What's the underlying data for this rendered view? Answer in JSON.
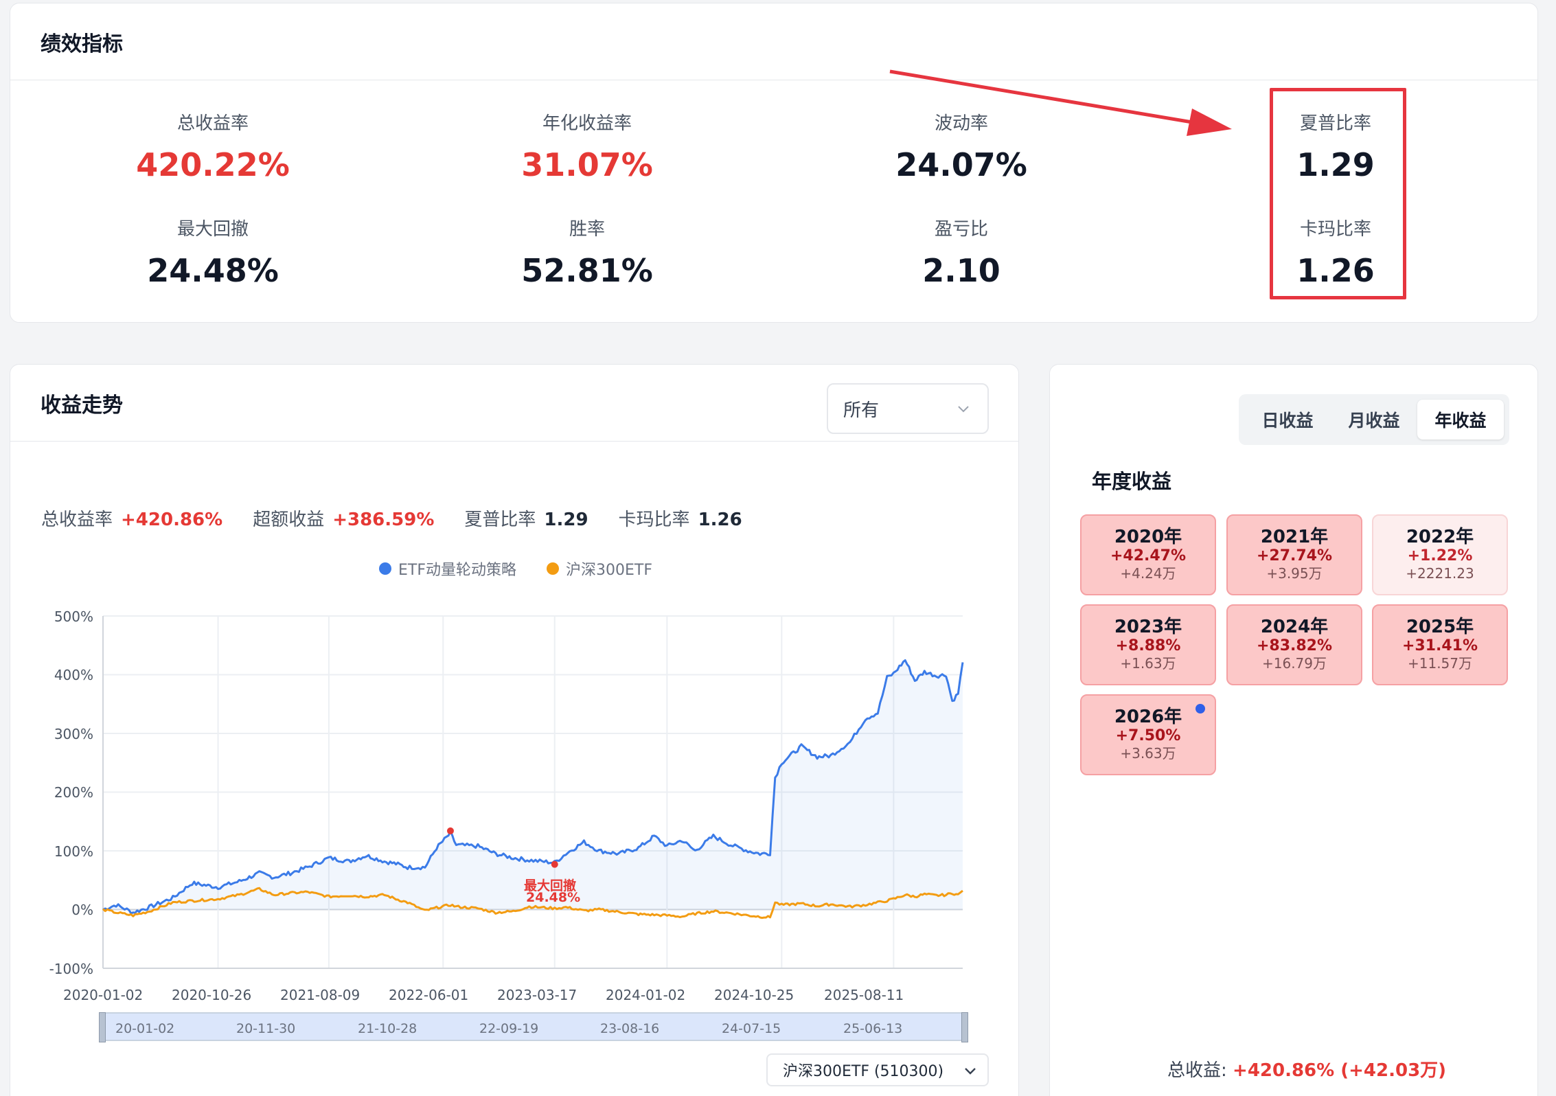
{
  "metrics_card": {
    "title": "绩效指标",
    "items": [
      {
        "label": "总收益率",
        "value": "420.22%"
      },
      {
        "label": "年化收益率",
        "value": "31.07%"
      },
      {
        "label": "波动率",
        "value": "24.07%"
      },
      {
        "label": "夏普比率",
        "value": "1.29"
      },
      {
        "label": "最大回撤",
        "value": "24.48%"
      },
      {
        "label": "胜率",
        "value": "52.81%"
      },
      {
        "label": "盈亏比",
        "value": "2.10"
      },
      {
        "label": "卡玛比率",
        "value": "1.26"
      }
    ],
    "highlight_color": "#e6353f"
  },
  "trend_card": {
    "title": "收益走势",
    "range_select": "所有",
    "stats": [
      {
        "label": "总收益率",
        "value": "+420.86%"
      },
      {
        "label": "超额收益",
        "value": "+386.59%"
      },
      {
        "label": "夏普比率",
        "value": "1.29"
      },
      {
        "label": "卡玛比率",
        "value": "1.26"
      }
    ],
    "legend": [
      {
        "name": "ETF动量轮动策略",
        "color": "#3b7be8"
      },
      {
        "name": "沪深300ETF",
        "color": "#f39c12"
      }
    ],
    "drawdown_annotation": {
      "label": "最大回撤",
      "value": "24.48%"
    },
    "slider_labels": [
      "20-01-02",
      "20-11-30",
      "21-10-28",
      "22-09-19",
      "23-08-16",
      "24-07-15",
      "25-06-13"
    ],
    "benchmark_select": "沪深300ETF (510300)"
  },
  "chart_data": {
    "type": "line",
    "x_tick_labels": [
      "2020-01-02",
      "2020-10-26",
      "2021-08-09",
      "2022-06-01",
      "2023-03-17",
      "2024-01-02",
      "2024-10-25",
      "2025-08-11"
    ],
    "y_tick_labels": [
      "500%",
      "400%",
      "300%",
      "200%",
      "100%",
      "0%",
      "-100%"
    ],
    "ylim": [
      -100,
      500
    ],
    "x_range": [
      "2020-01-02",
      "2026-02-06"
    ],
    "grid": true,
    "legend_position": "top",
    "series": [
      {
        "name": "ETF动量轮动策略",
        "color": "#3b7be8",
        "area": true,
        "points": [
          [
            "2020-01-02",
            0
          ],
          [
            "2020-02-05",
            8
          ],
          [
            "2020-03-20",
            -5
          ],
          [
            "2020-05-01",
            4
          ],
          [
            "2020-07-01",
            20
          ],
          [
            "2020-08-20",
            45
          ],
          [
            "2020-10-26",
            38
          ],
          [
            "2020-12-20",
            48
          ],
          [
            "2021-02-10",
            62
          ],
          [
            "2021-03-20",
            55
          ],
          [
            "2021-05-01",
            62
          ],
          [
            "2021-06-15",
            72
          ],
          [
            "2021-08-09",
            88
          ],
          [
            "2021-09-30",
            82
          ],
          [
            "2021-11-15",
            92
          ],
          [
            "2021-12-31",
            82
          ],
          [
            "2022-01-30",
            78
          ],
          [
            "2022-03-01",
            72
          ],
          [
            "2022-04-15",
            72
          ],
          [
            "2022-05-15",
            105
          ],
          [
            "2022-06-20",
            130
          ],
          [
            "2022-07-05",
            110
          ],
          [
            "2022-08-30",
            108
          ],
          [
            "2022-10-15",
            95
          ],
          [
            "2022-11-30",
            88
          ],
          [
            "2023-01-10",
            84
          ],
          [
            "2023-03-17",
            80
          ],
          [
            "2023-04-15",
            95
          ],
          [
            "2023-06-01",
            115
          ],
          [
            "2023-07-10",
            100
          ],
          [
            "2023-08-30",
            95
          ],
          [
            "2023-10-20",
            105
          ],
          [
            "2023-11-30",
            125
          ],
          [
            "2024-01-02",
            108
          ],
          [
            "2024-02-10",
            118
          ],
          [
            "2024-03-15",
            100
          ],
          [
            "2024-05-01",
            125
          ],
          [
            "2024-06-15",
            110
          ],
          [
            "2024-07-30",
            100
          ],
          [
            "2024-08-30",
            95
          ],
          [
            "2024-09-25",
            96
          ],
          [
            "2024-10-08",
            225
          ],
          [
            "2024-10-25",
            250
          ],
          [
            "2024-12-15",
            278
          ],
          [
            "2025-01-25",
            260
          ],
          [
            "2025-03-01",
            262
          ],
          [
            "2025-04-20",
            285
          ],
          [
            "2025-05-30",
            325
          ],
          [
            "2025-07-01",
            335
          ],
          [
            "2025-07-25",
            395
          ],
          [
            "2025-08-11",
            402
          ],
          [
            "2025-09-10",
            425
          ],
          [
            "2025-10-05",
            390
          ],
          [
            "2025-10-30",
            405
          ],
          [
            "2025-11-30",
            398
          ],
          [
            "2025-12-25",
            400
          ],
          [
            "2026-01-10",
            355
          ],
          [
            "2026-01-25",
            368
          ],
          [
            "2026-02-06",
            421
          ]
        ]
      },
      {
        "name": "沪深300ETF",
        "color": "#f39c12",
        "area": false,
        "points": [
          [
            "2020-01-02",
            0
          ],
          [
            "2020-02-05",
            -5
          ],
          [
            "2020-03-20",
            -10
          ],
          [
            "2020-05-01",
            -3
          ],
          [
            "2020-07-01",
            12
          ],
          [
            "2020-08-20",
            15
          ],
          [
            "2020-10-26",
            18
          ],
          [
            "2020-12-20",
            25
          ],
          [
            "2021-02-10",
            35
          ],
          [
            "2021-03-20",
            25
          ],
          [
            "2021-05-01",
            28
          ],
          [
            "2021-06-15",
            30
          ],
          [
            "2021-08-09",
            22
          ],
          [
            "2021-09-30",
            24
          ],
          [
            "2021-11-15",
            22
          ],
          [
            "2021-12-31",
            25
          ],
          [
            "2022-01-30",
            18
          ],
          [
            "2022-03-01",
            12
          ],
          [
            "2022-04-15",
            -2
          ],
          [
            "2022-05-15",
            3
          ],
          [
            "2022-06-20",
            8
          ],
          [
            "2022-07-05",
            5
          ],
          [
            "2022-08-30",
            2
          ],
          [
            "2022-10-15",
            -5
          ],
          [
            "2022-11-30",
            -3
          ],
          [
            "2023-01-10",
            5
          ],
          [
            "2023-03-17",
            2
          ],
          [
            "2023-04-15",
            4
          ],
          [
            "2023-06-01",
            -2
          ],
          [
            "2023-07-10",
            0
          ],
          [
            "2023-08-30",
            -4
          ],
          [
            "2023-10-20",
            -8
          ],
          [
            "2023-11-30",
            -9
          ],
          [
            "2024-01-02",
            -10
          ],
          [
            "2024-02-10",
            -12
          ],
          [
            "2024-03-15",
            -7
          ],
          [
            "2024-05-01",
            -3
          ],
          [
            "2024-06-15",
            -6
          ],
          [
            "2024-07-30",
            -10
          ],
          [
            "2024-08-30",
            -12
          ],
          [
            "2024-09-25",
            -13
          ],
          [
            "2024-10-08",
            12
          ],
          [
            "2024-10-25",
            8
          ],
          [
            "2024-12-15",
            10
          ],
          [
            "2025-01-25",
            6
          ],
          [
            "2025-03-01",
            9
          ],
          [
            "2025-04-20",
            5
          ],
          [
            "2025-05-30",
            8
          ],
          [
            "2025-07-01",
            12
          ],
          [
            "2025-07-25",
            15
          ],
          [
            "2025-08-11",
            18
          ],
          [
            "2025-09-10",
            25
          ],
          [
            "2025-10-05",
            22
          ],
          [
            "2025-10-30",
            26
          ],
          [
            "2025-11-30",
            24
          ],
          [
            "2025-12-25",
            25
          ],
          [
            "2026-01-10",
            28
          ],
          [
            "2026-01-25",
            25
          ],
          [
            "2026-02-06",
            32
          ]
        ]
      }
    ],
    "markers": [
      {
        "x": "2022-06-20",
        "y": 134,
        "color": "#e53935"
      },
      {
        "x": "2023-03-17",
        "y": 77,
        "color": "#e53935"
      }
    ]
  },
  "annual_card": {
    "tabs": [
      "日收益",
      "月收益",
      "年收益"
    ],
    "active_tab": "年收益",
    "title": "年度收益",
    "years": [
      {
        "year": "2020年",
        "pct": "+42.47%",
        "amount": "+4.24万"
      },
      {
        "year": "2021年",
        "pct": "+27.74%",
        "amount": "+3.95万"
      },
      {
        "year": "2022年",
        "pct": "+1.22%",
        "amount": "+2221.23"
      },
      {
        "year": "2023年",
        "pct": "+8.88%",
        "amount": "+1.63万"
      },
      {
        "year": "2024年",
        "pct": "+83.82%",
        "amount": "+16.79万"
      },
      {
        "year": "2025年",
        "pct": "+31.41%",
        "amount": "+11.57万"
      },
      {
        "year": "2026年",
        "pct": "+7.50%",
        "amount": "+3.63万"
      }
    ],
    "total_label": "总收益:",
    "total_value": "+420.86% (+42.03万)"
  }
}
